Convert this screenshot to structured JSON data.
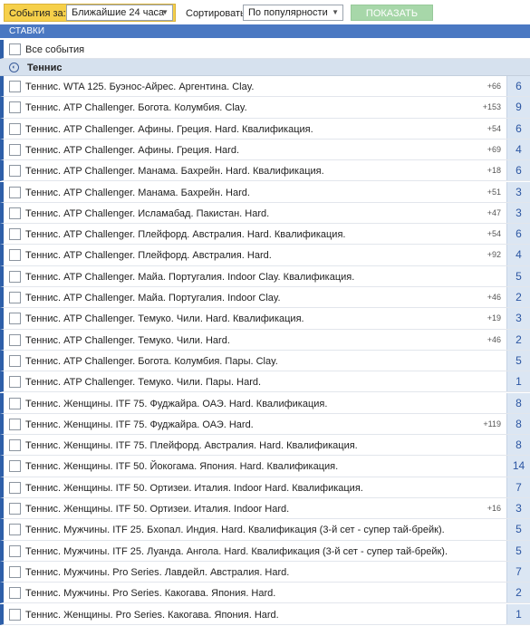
{
  "filters": {
    "events_label": "События за:",
    "events_value": "Ближайшие 24 часа",
    "sort_label": "Сортировать",
    "sort_value": "По популярности",
    "show_button": "ПОКАЗАТЬ"
  },
  "section": {
    "title": "СТАВКИ"
  },
  "all_events_label": "Все события",
  "group": {
    "label": "Теннис",
    "icon": "tennis-ball-icon"
  },
  "events": [
    {
      "name": "Теннис. WTA 125. Буэнос-Айрес. Аргентина. Clay.",
      "plus": "+66",
      "count": "6"
    },
    {
      "name": "Теннис. ATP Challenger. Богота. Колумбия. Clay.",
      "plus": "+153",
      "count": "9"
    },
    {
      "name": "Теннис. ATP Challenger. Афины. Греция. Hard. Квалификация.",
      "plus": "+54",
      "count": "6"
    },
    {
      "name": "Теннис. ATP Challenger. Афины. Греция. Hard.",
      "plus": "+69",
      "count": "4"
    },
    {
      "name": "Теннис. ATP Challenger. Манама. Бахрейн. Hard. Квалификация.",
      "plus": "+18",
      "count": "6"
    },
    {
      "name": "Теннис. ATP Challenger. Манама. Бахрейн. Hard.",
      "plus": "+51",
      "count": "3"
    },
    {
      "name": "Теннис. ATP Challenger. Исламабад. Пакистан. Hard.",
      "plus": "+47",
      "count": "3"
    },
    {
      "name": "Теннис. ATP Challenger. Плейфорд. Австралия. Hard. Квалификация.",
      "plus": "+54",
      "count": "6"
    },
    {
      "name": "Теннис. ATP Challenger. Плейфорд. Австралия. Hard.",
      "plus": "+92",
      "count": "4"
    },
    {
      "name": "Теннис. ATP Challenger. Майа. Португалия. Indoor Clay. Квалификация.",
      "plus": "",
      "count": "5"
    },
    {
      "name": "Теннис. ATP Challenger. Майа. Португалия. Indoor Clay.",
      "plus": "+46",
      "count": "2"
    },
    {
      "name": "Теннис. ATP Challenger. Темуко. Чили. Hard. Квалификация.",
      "plus": "+19",
      "count": "3"
    },
    {
      "name": "Теннис. ATP Challenger. Темуко. Чили. Hard.",
      "plus": "+46",
      "count": "2"
    },
    {
      "name": "Теннис. ATP Challenger. Богота. Колумбия. Пары. Clay.",
      "plus": "",
      "count": "5"
    },
    {
      "name": "Теннис. ATP Challenger. Темуко. Чили. Пары. Hard.",
      "plus": "",
      "count": "1"
    },
    {
      "name": "Теннис. Женщины. ITF 75. Фуджайра. ОАЭ. Hard. Квалификация.",
      "plus": "",
      "count": "8"
    },
    {
      "name": "Теннис. Женщины. ITF 75. Фуджайра. ОАЭ. Hard.",
      "plus": "+119",
      "count": "8"
    },
    {
      "name": "Теннис. Женщины. ITF 75. Плейфорд. Австралия. Hard. Квалификация.",
      "plus": "",
      "count": "8"
    },
    {
      "name": "Теннис. Женщины. ITF 50. Йокогама. Япония. Hard. Квалификация.",
      "plus": "",
      "count": "14"
    },
    {
      "name": "Теннис. Женщины. ITF 50. Ортизеи. Италия. Indoor Hard. Квалификация.",
      "plus": "",
      "count": "7"
    },
    {
      "name": "Теннис. Женщины. ITF 50. Ортизеи. Италия. Indoor Hard.",
      "plus": "+16",
      "count": "3"
    },
    {
      "name": "Теннис. Мужчины. ITF 25. Бхопал. Индия. Hard. Квалификация (3-й сет - супер тай-брейк).",
      "plus": "",
      "count": "5"
    },
    {
      "name": "Теннис. Мужчины. ITF 25. Луанда. Ангола. Hard. Квалификация (3-й сет - супер тай-брейк).",
      "plus": "",
      "count": "5"
    },
    {
      "name": "Теннис. Мужчины. Pro Series. Лавдейл. Австралия. Hard.",
      "plus": "",
      "count": "7"
    },
    {
      "name": "Теннис. Мужчины. Pro Series. Какогава. Япония. Hard.",
      "plus": "",
      "count": "2"
    },
    {
      "name": "Теннис. Женщины. Pro Series. Какогава. Япония. Hard.",
      "plus": "",
      "count": "1"
    }
  ]
}
